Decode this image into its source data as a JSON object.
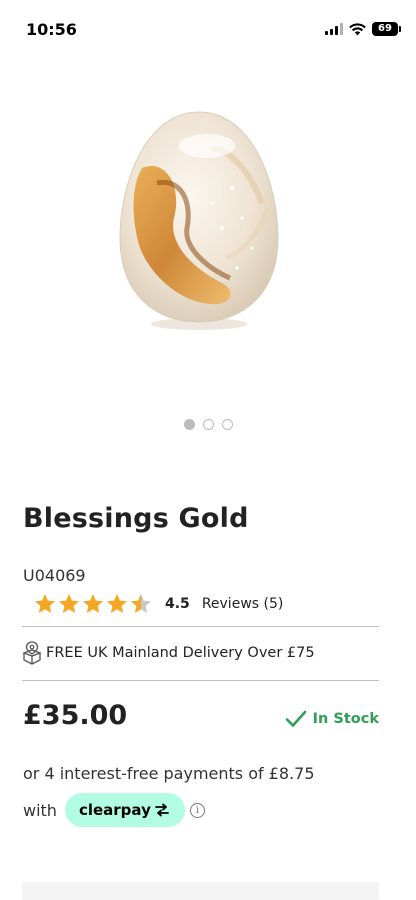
{
  "status_bar": {
    "time": "10:56",
    "battery": "69"
  },
  "product": {
    "title": "Blessings Gold",
    "sku": "U04069",
    "rating": 4.5,
    "rating_text": "4.5",
    "reviews_label": "Reviews (5)",
    "delivery_text": "FREE UK Mainland Delivery Over £75",
    "price": "£35.00",
    "stock_status": "In Stock"
  },
  "carousel": {
    "dots": 3,
    "active_index": 0
  },
  "payment": {
    "installments_text": "or 4 interest-free payments of £8.75",
    "with_text": "with",
    "provider": "clearpay"
  },
  "colors": {
    "star": "#f5a623",
    "stock": "#2f9e57",
    "clearpay_bg": "#b2fce4"
  },
  "icons": [
    "signal-icon",
    "wifi-icon",
    "battery-icon",
    "star-icon",
    "delivery-box-icon",
    "check-icon",
    "clearpay-arrows-icon",
    "info-icon"
  ]
}
